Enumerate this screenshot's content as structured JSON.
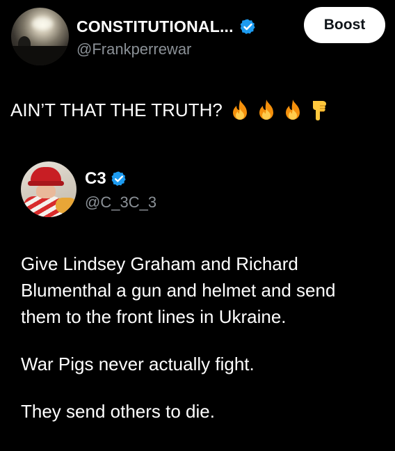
{
  "author": {
    "display_name": "CONSTITUTIONAL...",
    "handle": "@Frankperrewar",
    "verified": true
  },
  "action_button": {
    "label": "Boost"
  },
  "post": {
    "text": "AIN’T THAT THE TRUTH?",
    "emojis": [
      "fire-emoji",
      "fire-emoji",
      "fire-emoji",
      "backhand-index-pointing-down-emoji"
    ]
  },
  "quoted_post": {
    "author": {
      "display_name": "C3",
      "handle": "@C_3C_3",
      "verified": true
    },
    "paragraphs": [
      "Give Lindsey Graham and Richard\nBlumenthal a gun and helmet and send\nthem to the front lines in Ukraine.",
      "War Pigs never actually fight.",
      "They send others to die."
    ]
  },
  "colors": {
    "background": "#000000",
    "text_primary": "#ffffff",
    "text_secondary": "#8b9197",
    "verified_blue": "#1d9bf0",
    "button_bg": "#ffffff",
    "button_text": "#0f1419"
  }
}
